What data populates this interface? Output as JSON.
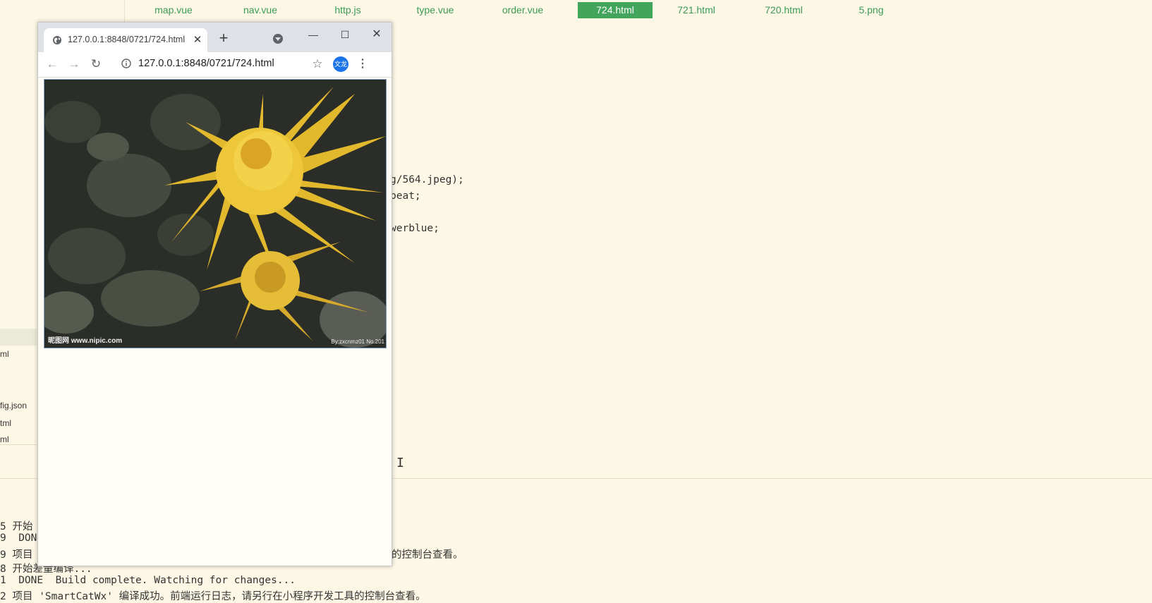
{
  "editor": {
    "tabs": [
      {
        "label": "map.vue"
      },
      {
        "label": "nav.vue"
      },
      {
        "label": "http.js"
      },
      {
        "label": "type.vue"
      },
      {
        "label": "order.vue"
      },
      {
        "label": "724.html"
      },
      {
        "label": "721.html"
      },
      {
        "label": "720.html"
      },
      {
        "label": "5.png"
      }
    ],
    "code_lines": [
      "g/564.jpeg);",
      "peat;",
      "werblue;"
    ]
  },
  "sidebar": {
    "files": [
      {
        "label": "ml"
      },
      {
        "label": "fig.json"
      },
      {
        "label": "tml"
      },
      {
        "label": "ml"
      }
    ]
  },
  "console": {
    "lines": [
      "5 开始",
      "9  DON",
      "9 项目",
      "8 开始差量编译...",
      "1  DONE  Build complete. Watching for changes...",
      "2 项目 'SmartCatWx' 编译成功。前端运行日志，请另行在小程序开发工具的控制台查看。"
    ],
    "partial_line_tail": "的控制台查看。"
  },
  "browser": {
    "tab_title": "127.0.0.1:8848/0721/724.html",
    "url": "127.0.0.1:8848/0721/724.html",
    "profile_avatar_text": "文龙",
    "image": {
      "alt_subject": "yellow chrysanthemum",
      "watermark_left": "昵图网 www.nipic.com",
      "watermark_right": "By:zxcnmz01  No.201"
    }
  },
  "colors": {
    "ide_background": "#fdf8e6",
    "active_tab": "#43a55c",
    "tab_text": "#3c9a57",
    "avatar": "#1a73e8"
  },
  "icons": {
    "tab_favicon": "globe-icon",
    "tab_close": "close-icon",
    "new_tab": "plus-icon",
    "tab_search": "chevron-down-icon",
    "minimize": "minimize-icon",
    "maximize": "maximize-icon",
    "close_window": "close-icon",
    "back": "back-arrow-icon",
    "forward": "forward-arrow-icon",
    "reload": "reload-icon",
    "site_info": "info-icon",
    "bookmark": "star-icon",
    "menu": "kebab-menu-icon"
  }
}
